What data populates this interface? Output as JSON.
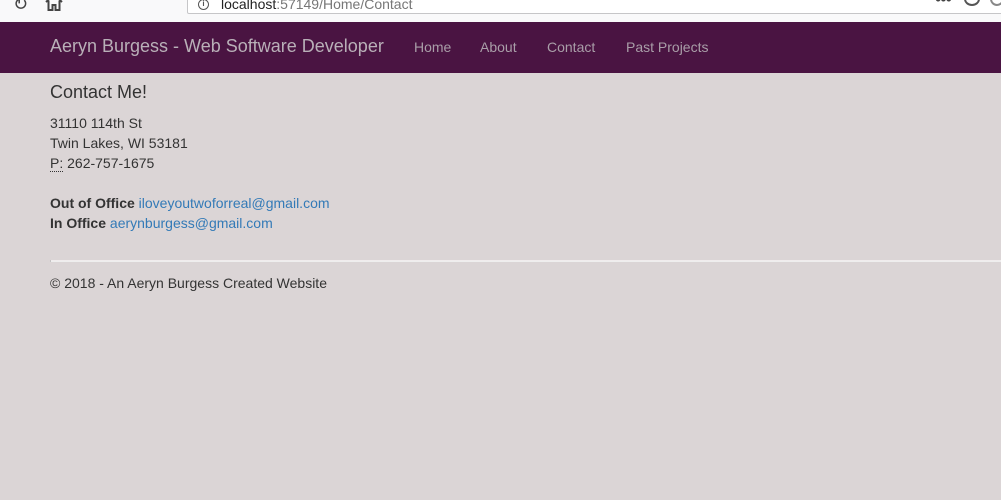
{
  "browser": {
    "url_host": "localhost",
    "url_rest": ":57149/Home/Contact"
  },
  "navbar": {
    "brand": "Aeryn Burgess - Web Software Developer",
    "links": [
      "Home",
      "About",
      "Contact",
      "Past Projects"
    ],
    "background_color": "#4a1442"
  },
  "contact": {
    "title": "Contact Me!",
    "address_line1": "31110 114th St",
    "address_line2": "Twin Lakes, WI 53181",
    "phone_label": "P:",
    "phone_number": "262-757-1675",
    "emails": [
      {
        "label": "Out of Office",
        "address": "iloveyoutwoforreal@gmail.com"
      },
      {
        "label": "In Office",
        "address": "aerynburgess@gmail.com"
      }
    ]
  },
  "footer": {
    "text": "© 2018 - An Aeryn Burgess Created Website"
  },
  "icons": [
    "reload-icon",
    "home-icon",
    "info-icon",
    "menu-dots-icon",
    "pocket-icon"
  ]
}
